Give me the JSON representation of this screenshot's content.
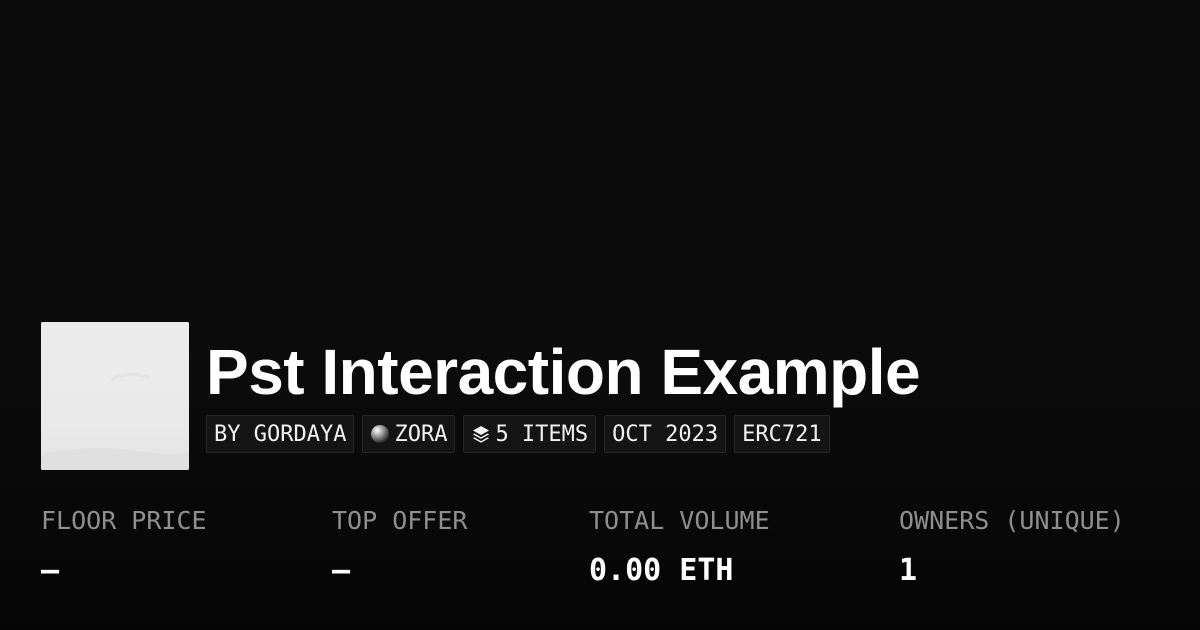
{
  "collection": {
    "title": "Pst Interaction Example",
    "thumbnail": {
      "background": "#eeeeee",
      "description_icon": "image-thumbnail"
    }
  },
  "tags": {
    "creator": "BY GORDAYA",
    "chain": {
      "label": "ZORA",
      "icon": "zora-orb-icon"
    },
    "items": {
      "label": "5 ITEMS",
      "icon": "layers-icon"
    },
    "date": "OCT 2023",
    "standard": "ERC721"
  },
  "stats": {
    "floor_price": {
      "label": "FLOOR PRICE",
      "value": "–"
    },
    "top_offer": {
      "label": "TOP OFFER",
      "value": "–"
    },
    "total_volume": {
      "label": "TOTAL VOLUME",
      "value": "0.00 ETH"
    },
    "owners": {
      "label": "OWNERS (UNIQUE)",
      "value": "1"
    }
  },
  "colors": {
    "background": "#0b0b0b",
    "text_primary": "#ffffff",
    "text_muted": "#8f8f8f",
    "tag_background": "#141414",
    "tag_border": "#262626"
  }
}
